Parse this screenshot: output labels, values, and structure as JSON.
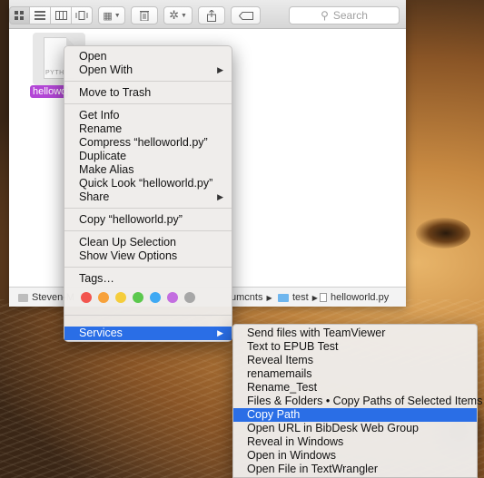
{
  "toolbar": {
    "search_placeholder": "Search",
    "view_icons": [
      "icon-view-icon",
      "list-view-icon",
      "column-view-icon",
      "coverflow-view-icon"
    ]
  },
  "file": {
    "type_label": "PYTH",
    "name_visible": "hellowo"
  },
  "pathbar": {
    "root": "Steven-M",
    "documents": "umcnts",
    "test": "test",
    "file": "helloworld.py"
  },
  "context_menu": {
    "open": "Open",
    "open_with": "Open With",
    "move_to_trash": "Move to Trash",
    "get_info": "Get Info",
    "rename": "Rename",
    "compress": "Compress “helloworld.py”",
    "duplicate": "Duplicate",
    "make_alias": "Make Alias",
    "quick_look": "Quick Look “helloworld.py”",
    "share": "Share",
    "copy": "Copy “helloworld.py”",
    "clean_up": "Clean Up Selection",
    "show_view_options": "Show View Options",
    "tags": "Tags…",
    "services": "Services",
    "submenu_arrow": "▶"
  },
  "tag_colors": [
    "#f2554f",
    "#f7a13a",
    "#f5cd3b",
    "#5bc84d",
    "#3fa9f3",
    "#c36ee0",
    "#a7a7a7"
  ],
  "services_menu": {
    "items": [
      "Send files with TeamViewer",
      "Text to EPUB Test",
      "Reveal Items",
      "renamemails",
      "Rename_Test",
      "Files & Folders • Copy Paths of Selected Items",
      "Copy Path",
      "Open URL in BibDesk Web Group",
      "Reveal in Windows",
      "Open in Windows",
      "Open File in TextWrangler"
    ],
    "highlighted": "Copy Path"
  },
  "colors": {
    "highlight": "#2a6ee6",
    "file_selection": "#b347d6"
  }
}
